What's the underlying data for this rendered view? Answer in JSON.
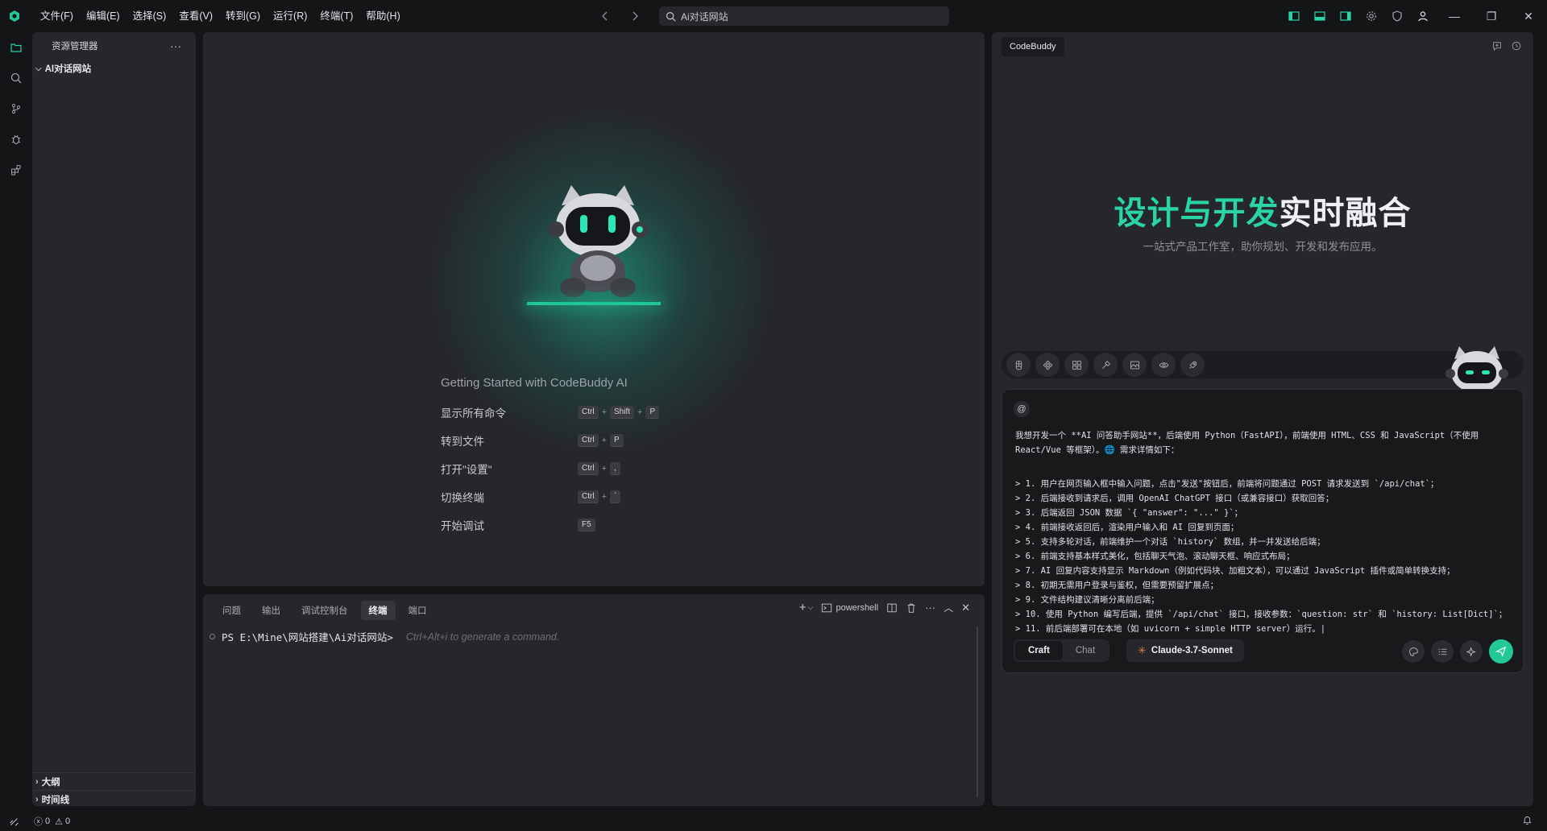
{
  "titlebar": {
    "menus": [
      "文件(F)",
      "编辑(E)",
      "选择(S)",
      "查看(V)",
      "转到(G)",
      "运行(R)",
      "终端(T)",
      "帮助(H)"
    ],
    "search_text": "Ai对话网站"
  },
  "sidebar": {
    "title": "资源管理器",
    "folder": "AI对话网站",
    "outline": "大纲",
    "timeline": "时间线"
  },
  "welcome": {
    "title": "Getting Started with CodeBuddy AI",
    "commands": [
      {
        "label": "显示所有命令",
        "keys": [
          "Ctrl",
          "Shift",
          "P"
        ]
      },
      {
        "label": "转到文件",
        "keys": [
          "Ctrl",
          "P"
        ]
      },
      {
        "label": "打开\"设置\"",
        "keys": [
          "Ctrl",
          ","
        ]
      },
      {
        "label": "切换终端",
        "keys": [
          "Ctrl",
          "`"
        ]
      },
      {
        "label": "开始调试",
        "keys": [
          "F5"
        ]
      }
    ]
  },
  "panel": {
    "tabs": [
      "问题",
      "输出",
      "调试控制台",
      "终端",
      "端口"
    ],
    "active_tab": "终端",
    "shell_name": "powershell",
    "prompt": "PS E:\\Mine\\网站搭建\\Ai对话网站>",
    "hint": "Ctrl+Alt+i to generate a command."
  },
  "codebuddy": {
    "tab_label": "CodeBuddy",
    "hero_green": "设计与开发",
    "hero_white": "实时融合",
    "hero_sub": "一站式产品工作室，助你规划、开发和发布应用。",
    "at_symbol": "@",
    "intro_line1": "我想开发一个 **AI 问答助手网站**，后端使用 Python（FastAPI），前端使用 HTML、CSS 和 JavaScript（不使用",
    "intro_line2": "React/Vue 等框架）。🌐 需求详情如下：",
    "requirements": [
      "> 1. 用户在网页输入框中输入问题，点击\"发送\"按钮后，前端将问题通过 POST 请求发送到 `/api/chat`；",
      "> 2. 后端接收到请求后，调用 OpenAI ChatGPT 接口（或兼容接口）获取回答；",
      "> 3. 后端返回 JSON 数据 `{ \"answer\": \"...\" }`；",
      "> 4. 前端接收返回后，渲染用户输入和 AI 回复到页面；",
      "> 5. 支持多轮对话，前端维护一个对话 `history` 数组，并一并发送给后端；",
      "> 6. 前端支持基本样式美化，包括聊天气泡、滚动聊天框、响应式布局；",
      "> 7. AI 回复内容支持显示 Markdown（例如代码块、加粗文本），可以通过 JavaScript 插件或简单转换支持；",
      "> 8. 初期无需用户登录与鉴权，但需要预留扩展点；",
      "> 9. 文件结构建议清晰分离前后端；",
      "> 10. 使用 Python 编写后端，提供 `/api/chat` 接口，接收参数：`question: str` 和 `history: List[Dict]`；",
      "> 11. 前后端部署可在本地（如 uvicorn + simple HTTP server）运行。|"
    ],
    "modes": [
      "Craft",
      "Chat"
    ],
    "active_mode": "Craft",
    "model": "Claude-3.7-Sonnet"
  },
  "statusbar": {
    "errors": "0",
    "warnings": "0"
  },
  "colors": {
    "accent": "#22c997",
    "hero_green": "#2bd4a6",
    "background": "#141517",
    "panel": "#25272b"
  }
}
